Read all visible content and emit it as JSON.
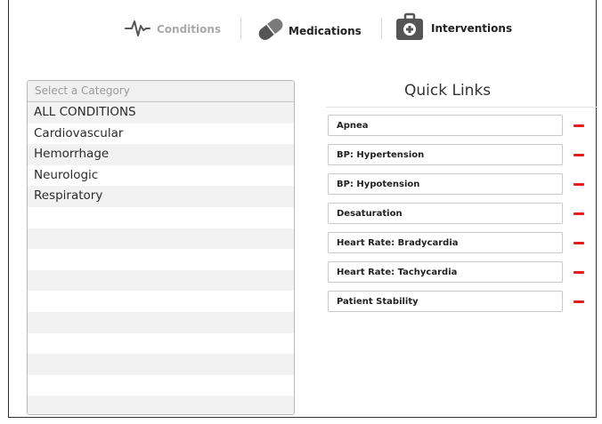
{
  "tabs": [
    {
      "label": "Conditions",
      "icon": "heartbeat-icon",
      "active": true
    },
    {
      "label": "Medications",
      "icon": "pill-icon",
      "active": false
    },
    {
      "label": "Interventions",
      "icon": "medical-kit-icon",
      "active": false
    }
  ],
  "category": {
    "placeholder": "Select a Category",
    "items": [
      "ALL CONDITIONS",
      "Cardiovascular",
      "Hemorrhage",
      "Neurologic",
      "Respiratory"
    ]
  },
  "quick_links": {
    "title": "Quick Links",
    "items": [
      "Apnea",
      "BP: Hypertension",
      "BP: Hypotension",
      "Desaturation",
      "Heart Rate: Bradycardia",
      "Heart Rate: Tachycardia",
      "Patient Stability"
    ]
  },
  "colors": {
    "remove": "#e02020",
    "inactive_tab": "#a9a9a9"
  }
}
